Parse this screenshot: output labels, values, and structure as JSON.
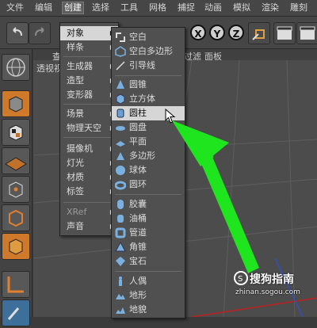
{
  "menubar": {
    "items": [
      "文件",
      "编辑",
      "创建",
      "选择",
      "工具",
      "网格",
      "捕捉",
      "动画",
      "模拟",
      "渲染",
      "雕刻"
    ],
    "active_index": 2
  },
  "toolbar": {
    "axis_x": "X",
    "axis_y": "Y",
    "axis_z": "Z"
  },
  "viewport": {
    "header_items": [
      "查",
      "透视视",
      "过滤",
      "面板"
    ]
  },
  "menu1": {
    "items": [
      {
        "label": "对象",
        "arrow": "▶",
        "state": "active"
      },
      {
        "label": "样条",
        "arrow": "▶",
        "state": "normal"
      },
      {
        "label": "生成器",
        "arrow": "▶",
        "state": "normal"
      },
      {
        "label": "造型",
        "arrow": "▶",
        "state": "normal"
      },
      {
        "label": "变形器",
        "arrow": "▶",
        "state": "normal"
      },
      {
        "label": "场景",
        "arrow": "▶",
        "state": "normal"
      },
      {
        "label": "物理天空",
        "arrow": "▶",
        "state": "normal"
      },
      {
        "label": "摄像机",
        "arrow": "▶",
        "state": "normal"
      },
      {
        "label": "灯光",
        "arrow": "▶",
        "state": "normal"
      },
      {
        "label": "材质",
        "arrow": "▶",
        "state": "normal"
      },
      {
        "label": "标签",
        "arrow": "▶",
        "state": "normal"
      },
      {
        "label": "XRef",
        "arrow": "▶",
        "state": "dim"
      },
      {
        "label": "声音",
        "arrow": "▶",
        "state": "normal"
      }
    ]
  },
  "menu2": {
    "items": [
      {
        "label": "空白",
        "icon": "null-object-icon",
        "state": "normal"
      },
      {
        "label": "空白多边形",
        "icon": "polygon-object-icon",
        "state": "normal"
      },
      {
        "label": "引导线",
        "icon": "guide-icon",
        "state": "normal"
      },
      {
        "label": "圆锥",
        "icon": "cone-icon",
        "state": "normal"
      },
      {
        "label": "立方体",
        "icon": "cube-icon",
        "state": "normal"
      },
      {
        "label": "圆柱",
        "icon": "cylinder-icon",
        "state": "active"
      },
      {
        "label": "圆盘",
        "icon": "disc-icon",
        "state": "normal"
      },
      {
        "label": "平面",
        "icon": "plane-icon",
        "state": "normal"
      },
      {
        "label": "多边形",
        "icon": "polygon-icon",
        "state": "normal"
      },
      {
        "label": "球体",
        "icon": "sphere-icon",
        "state": "normal"
      },
      {
        "label": "圆环",
        "icon": "torus-icon",
        "state": "normal"
      },
      {
        "label": "胶囊",
        "icon": "capsule-icon",
        "state": "normal"
      },
      {
        "label": "油桶",
        "icon": "oil-tank-icon",
        "state": "normal"
      },
      {
        "label": "管道",
        "icon": "tube-icon",
        "state": "normal"
      },
      {
        "label": "角锥",
        "icon": "pyramid-icon",
        "state": "normal"
      },
      {
        "label": "宝石",
        "icon": "gem-icon",
        "state": "normal"
      },
      {
        "label": "人偶",
        "icon": "figure-icon",
        "state": "normal"
      },
      {
        "label": "地形",
        "icon": "landscape-icon",
        "state": "normal"
      },
      {
        "label": "地貌",
        "icon": "relief-icon",
        "state": "normal"
      }
    ]
  },
  "watermark": {
    "brand": "搜狗指南",
    "url": "zhinan.sogou.com"
  },
  "colors": {
    "arrow_green": "#1fe51f",
    "menu_bg": "#505050",
    "highlight": "#d6d6d6",
    "accent_orange": "#cf7a2a"
  }
}
